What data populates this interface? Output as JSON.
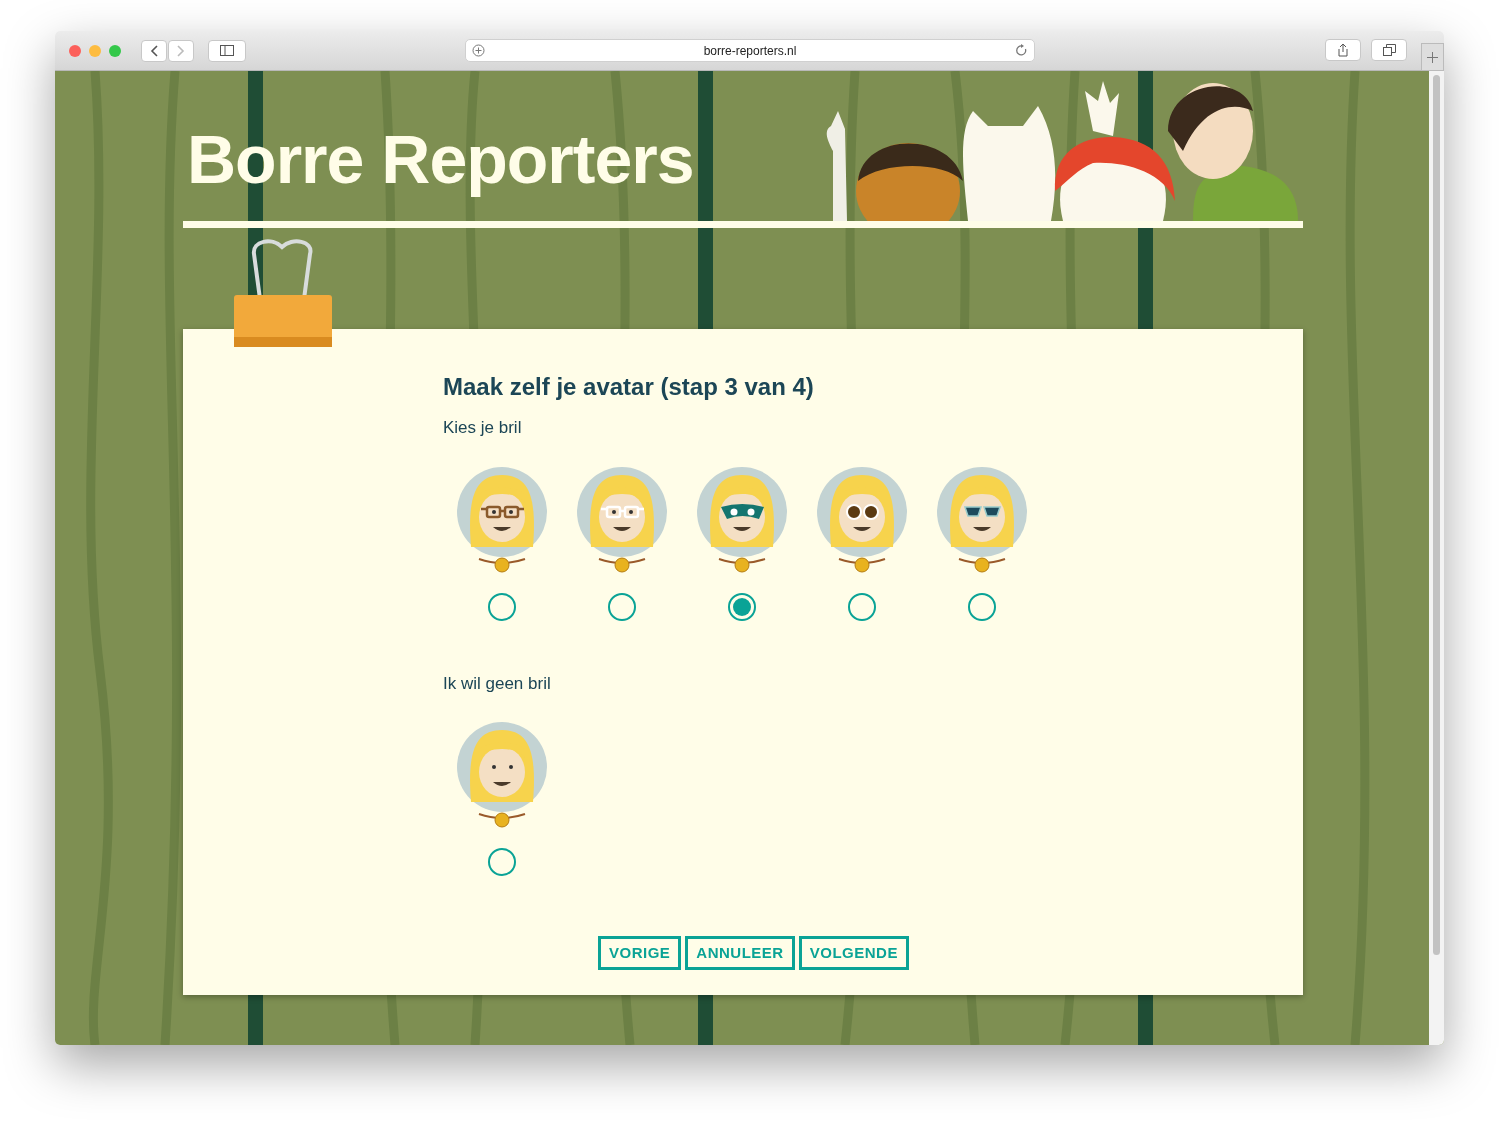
{
  "browser": {
    "url": "borre-reporters.nl"
  },
  "site": {
    "title": "Borre Reporters"
  },
  "form": {
    "heading": "Maak zelf je avatar (stap 3 van 4)",
    "groups": [
      {
        "label": "Kies je bril",
        "options": [
          {
            "kind": "brown-frames",
            "selected": false
          },
          {
            "kind": "white-frames",
            "selected": false
          },
          {
            "kind": "mask",
            "selected": true
          },
          {
            "kind": "round-dark",
            "selected": false
          },
          {
            "kind": "sunglasses",
            "selected": false
          }
        ]
      },
      {
        "label": "Ik wil geen bril",
        "options": [
          {
            "kind": "none",
            "selected": false
          }
        ]
      }
    ],
    "buttons": [
      "VORIGE",
      "ANNULEER",
      "VOLGENDE"
    ]
  }
}
